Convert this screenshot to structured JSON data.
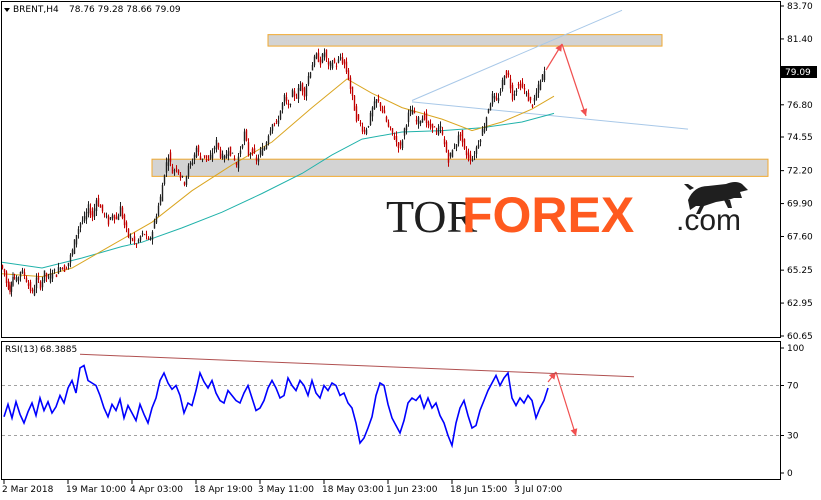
{
  "chart_data": {
    "type": "candlestick",
    "header": {
      "symbol": "BRENT,H4",
      "ohlc": "78.76 79.28 78.66 79.09"
    },
    "price_axis": {
      "ticks": [
        "83.70",
        "81.40",
        "79.15",
        "76.80",
        "74.55",
        "72.20",
        "69.90",
        "67.60",
        "65.25",
        "62.95",
        "60.65"
      ],
      "ylim": [
        60.65,
        83.7
      ],
      "current_price": "79.09"
    },
    "time_axis": {
      "labels": [
        "2 Mar 2018",
        "19 Mar 10:00",
        "4 Apr 03:00",
        "18 Apr 19:00",
        "3 May 11:00",
        "18 May 03:00",
        "1 Jun 23:00",
        "18 Jun 15:00",
        "3 Jul 07:00"
      ]
    },
    "price_path": [
      [
        0,
        65.6
      ],
      [
        4,
        65.1
      ],
      [
        6,
        64.4
      ],
      [
        9,
        63.9
      ],
      [
        12,
        64.8
      ],
      [
        16,
        64.5
      ],
      [
        20,
        65.2
      ],
      [
        24,
        64.9
      ],
      [
        28,
        64.2
      ],
      [
        32,
        63.6
      ],
      [
        36,
        64.6
      ],
      [
        40,
        64.2
      ],
      [
        44,
        65.0
      ],
      [
        48,
        64.6
      ],
      [
        52,
        65.2
      ],
      [
        56,
        65.0
      ],
      [
        60,
        65.6
      ],
      [
        64,
        65.3
      ],
      [
        68,
        65.8
      ],
      [
        72,
        66.6
      ],
      [
        76,
        67.8
      ],
      [
        80,
        68.6
      ],
      [
        84,
        68.8
      ],
      [
        88,
        69.6
      ],
      [
        92,
        69.0
      ],
      [
        96,
        70.2
      ],
      [
        100,
        69.6
      ],
      [
        104,
        69.1
      ],
      [
        108,
        68.6
      ],
      [
        112,
        69.2
      ],
      [
        116,
        68.8
      ],
      [
        120,
        69.6
      ],
      [
        124,
        68.4
      ],
      [
        128,
        67.6
      ],
      [
        132,
        67.4
      ],
      [
        136,
        67.0
      ],
      [
        140,
        67.6
      ],
      [
        144,
        67.8
      ],
      [
        148,
        67.2
      ],
      [
        152,
        68.0
      ],
      [
        156,
        69.2
      ],
      [
        160,
        70.3
      ],
      [
        164,
        72.1
      ],
      [
        168,
        73.3
      ],
      [
        172,
        72.1
      ],
      [
        176,
        72.5
      ],
      [
        180,
        71.8
      ],
      [
        184,
        71.4
      ],
      [
        188,
        72.4
      ],
      [
        192,
        72.9
      ],
      [
        196,
        73.8
      ],
      [
        200,
        73.0
      ],
      [
        204,
        73.3
      ],
      [
        208,
        72.8
      ],
      [
        212,
        73.5
      ],
      [
        216,
        74.2
      ],
      [
        220,
        73.3
      ],
      [
        224,
        73.0
      ],
      [
        228,
        73.8
      ],
      [
        232,
        73.2
      ],
      [
        236,
        72.6
      ],
      [
        240,
        73.7
      ],
      [
        244,
        74.8
      ],
      [
        248,
        73.4
      ],
      [
        252,
        73.6
      ],
      [
        256,
        72.8
      ],
      [
        260,
        73.5
      ],
      [
        264,
        73.8
      ],
      [
        268,
        74.8
      ],
      [
        272,
        75.6
      ],
      [
        276,
        75.4
      ],
      [
        280,
        76.4
      ],
      [
        284,
        77.3
      ],
      [
        288,
        76.6
      ],
      [
        292,
        77.6
      ],
      [
        296,
        77.4
      ],
      [
        300,
        78.2
      ],
      [
        304,
        77.6
      ],
      [
        308,
        78.8
      ],
      [
        312,
        79.7
      ],
      [
        316,
        80.2
      ],
      [
        320,
        79.8
      ],
      [
        324,
        80.5
      ],
      [
        328,
        79.4
      ],
      [
        332,
        79.8
      ],
      [
        336,
        79.6
      ],
      [
        340,
        80.1
      ],
      [
        344,
        79.6
      ],
      [
        348,
        78.7
      ],
      [
        352,
        77.2
      ],
      [
        356,
        75.9
      ],
      [
        360,
        75.4
      ],
      [
        364,
        74.9
      ],
      [
        368,
        75.5
      ],
      [
        372,
        76.5
      ],
      [
        376,
        77.1
      ],
      [
        380,
        76.8
      ],
      [
        384,
        76.0
      ],
      [
        388,
        75.2
      ],
      [
        392,
        74.8
      ],
      [
        396,
        74.2
      ],
      [
        400,
        73.8
      ],
      [
        404,
        75.1
      ],
      [
        408,
        76.1
      ],
      [
        412,
        76.4
      ],
      [
        416,
        75.6
      ],
      [
        420,
        75.8
      ],
      [
        424,
        76.0
      ],
      [
        428,
        75.2
      ],
      [
        432,
        75.4
      ],
      [
        436,
        74.8
      ],
      [
        440,
        75.2
      ],
      [
        444,
        74.0
      ],
      [
        448,
        73.0
      ],
      [
        452,
        73.6
      ],
      [
        456,
        74.2
      ],
      [
        460,
        74.8
      ],
      [
        464,
        73.6
      ],
      [
        468,
        73.2
      ],
      [
        472,
        73.0
      ],
      [
        476,
        73.8
      ],
      [
        480,
        74.6
      ],
      [
        484,
        75.4
      ],
      [
        488,
        76.6
      ],
      [
        492,
        77.4
      ],
      [
        496,
        77.0
      ],
      [
        500,
        77.8
      ],
      [
        504,
        79.0
      ],
      [
        508,
        78.8
      ],
      [
        512,
        77.4
      ],
      [
        516,
        78.0
      ],
      [
        520,
        78.2
      ],
      [
        524,
        77.8
      ],
      [
        528,
        77.2
      ],
      [
        532,
        76.8
      ],
      [
        536,
        77.6
      ],
      [
        540,
        78.4
      ],
      [
        544,
        79.1
      ]
    ],
    "ma_slow": [
      [
        0,
        65.8
      ],
      [
        40,
        65.4
      ],
      [
        80,
        66.1
      ],
      [
        120,
        66.9
      ],
      [
        140,
        67.2
      ],
      [
        180,
        68.2
      ],
      [
        220,
        69.3
      ],
      [
        260,
        70.6
      ],
      [
        300,
        72.0
      ],
      [
        330,
        73.3
      ],
      [
        360,
        74.4
      ],
      [
        400,
        74.9
      ],
      [
        440,
        75.0
      ],
      [
        480,
        75.2
      ],
      [
        520,
        75.6
      ],
      [
        552,
        76.2
      ]
    ],
    "ma_fast": [
      [
        0,
        65.0
      ],
      [
        40,
        64.8
      ],
      [
        70,
        65.4
      ],
      [
        110,
        67.0
      ],
      [
        150,
        68.6
      ],
      [
        190,
        70.8
      ],
      [
        230,
        72.6
      ],
      [
        270,
        74.2
      ],
      [
        310,
        76.6
      ],
      [
        345,
        78.6
      ],
      [
        370,
        77.6
      ],
      [
        400,
        76.6
      ],
      [
        440,
        75.8
      ],
      [
        470,
        75.0
      ],
      [
        500,
        75.6
      ],
      [
        530,
        76.5
      ],
      [
        552,
        77.4
      ]
    ],
    "rsi": {
      "label": "RSI(13)",
      "value": "68.3885",
      "ticks": [
        "100",
        "70",
        "30",
        "0"
      ],
      "path": [
        [
          2,
          45
        ],
        [
          6,
          55
        ],
        [
          10,
          44
        ],
        [
          14,
          57
        ],
        [
          18,
          47
        ],
        [
          22,
          40
        ],
        [
          26,
          49
        ],
        [
          30,
          56
        ],
        [
          34,
          46
        ],
        [
          38,
          60
        ],
        [
          42,
          50
        ],
        [
          46,
          57
        ],
        [
          50,
          48
        ],
        [
          54,
          53
        ],
        [
          58,
          62
        ],
        [
          62,
          56
        ],
        [
          66,
          68
        ],
        [
          70,
          74
        ],
        [
          74,
          64
        ],
        [
          78,
          84
        ],
        [
          82,
          86
        ],
        [
          86,
          74
        ],
        [
          90,
          72
        ],
        [
          94,
          70
        ],
        [
          98,
          62
        ],
        [
          102,
          52
        ],
        [
          106,
          45
        ],
        [
          110,
          55
        ],
        [
          114,
          50
        ],
        [
          118,
          59
        ],
        [
          122,
          44
        ],
        [
          126,
          54
        ],
        [
          130,
          48
        ],
        [
          134,
          42
        ],
        [
          138,
          55
        ],
        [
          142,
          47
        ],
        [
          146,
          40
        ],
        [
          150,
          52
        ],
        [
          154,
          60
        ],
        [
          158,
          74
        ],
        [
          162,
          80
        ],
        [
          166,
          72
        ],
        [
          170,
          67
        ],
        [
          174,
          70
        ],
        [
          178,
          62
        ],
        [
          182,
          48
        ],
        [
          186,
          56
        ],
        [
          190,
          54
        ],
        [
          194,
          66
        ],
        [
          198,
          80
        ],
        [
          202,
          73
        ],
        [
          206,
          68
        ],
        [
          210,
          74
        ],
        [
          214,
          64
        ],
        [
          218,
          58
        ],
        [
          222,
          56
        ],
        [
          226,
          66
        ],
        [
          230,
          62
        ],
        [
          234,
          58
        ],
        [
          238,
          56
        ],
        [
          242,
          64
        ],
        [
          246,
          70
        ],
        [
          250,
          60
        ],
        [
          254,
          50
        ],
        [
          258,
          52
        ],
        [
          262,
          58
        ],
        [
          266,
          68
        ],
        [
          270,
          74
        ],
        [
          274,
          68
        ],
        [
          278,
          60
        ],
        [
          282,
          62
        ],
        [
          286,
          76
        ],
        [
          290,
          70
        ],
        [
          294,
          66
        ],
        [
          298,
          74
        ],
        [
          302,
          70
        ],
        [
          306,
          62
        ],
        [
          310,
          74
        ],
        [
          314,
          64
        ],
        [
          318,
          60
        ],
        [
          322,
          70
        ],
        [
          326,
          66
        ],
        [
          330,
          72
        ],
        [
          334,
          70
        ],
        [
          338,
          62
        ],
        [
          342,
          64
        ],
        [
          346,
          56
        ],
        [
          350,
          52
        ],
        [
          354,
          40
        ],
        [
          358,
          24
        ],
        [
          362,
          28
        ],
        [
          366,
          36
        ],
        [
          370,
          45
        ],
        [
          374,
          62
        ],
        [
          378,
          72
        ],
        [
          382,
          70
        ],
        [
          386,
          55
        ],
        [
          390,
          44
        ],
        [
          394,
          38
        ],
        [
          398,
          32
        ],
        [
          402,
          42
        ],
        [
          406,
          56
        ],
        [
          410,
          60
        ],
        [
          414,
          58
        ],
        [
          418,
          62
        ],
        [
          422,
          52
        ],
        [
          426,
          60
        ],
        [
          430,
          52
        ],
        [
          434,
          56
        ],
        [
          438,
          46
        ],
        [
          442,
          40
        ],
        [
          446,
          30
        ],
        [
          450,
          22
        ],
        [
          454,
          40
        ],
        [
          458,
          52
        ],
        [
          462,
          58
        ],
        [
          466,
          46
        ],
        [
          470,
          36
        ],
        [
          474,
          38
        ],
        [
          478,
          50
        ],
        [
          482,
          58
        ],
        [
          486,
          66
        ],
        [
          490,
          72
        ],
        [
          494,
          78
        ],
        [
          498,
          70
        ],
        [
          502,
          76
        ],
        [
          506,
          80
        ],
        [
          510,
          60
        ],
        [
          514,
          54
        ],
        [
          518,
          60
        ],
        [
          522,
          56
        ],
        [
          526,
          62
        ],
        [
          530,
          58
        ],
        [
          534,
          44
        ],
        [
          538,
          52
        ],
        [
          542,
          58
        ],
        [
          546,
          68
        ]
      ]
    },
    "colors": {
      "candle": "#c00000",
      "candle_alt": "#222222",
      "ma_slow": "#20b2aa",
      "ma_fast": "#daa520",
      "rsi": "#0000ff",
      "zone_fill": "#d3d3d3",
      "zone_border": "#f0a830",
      "trendline": "#a8c8e8",
      "rsi_trendline": "#b05050",
      "arrow": "#f05050"
    },
    "zones": [
      [
        80.9,
        81.7
      ],
      [
        71.8,
        73.0
      ]
    ]
  },
  "logo": {
    "tor": "TOR",
    "forex": "FOREX",
    "com": ".com"
  }
}
